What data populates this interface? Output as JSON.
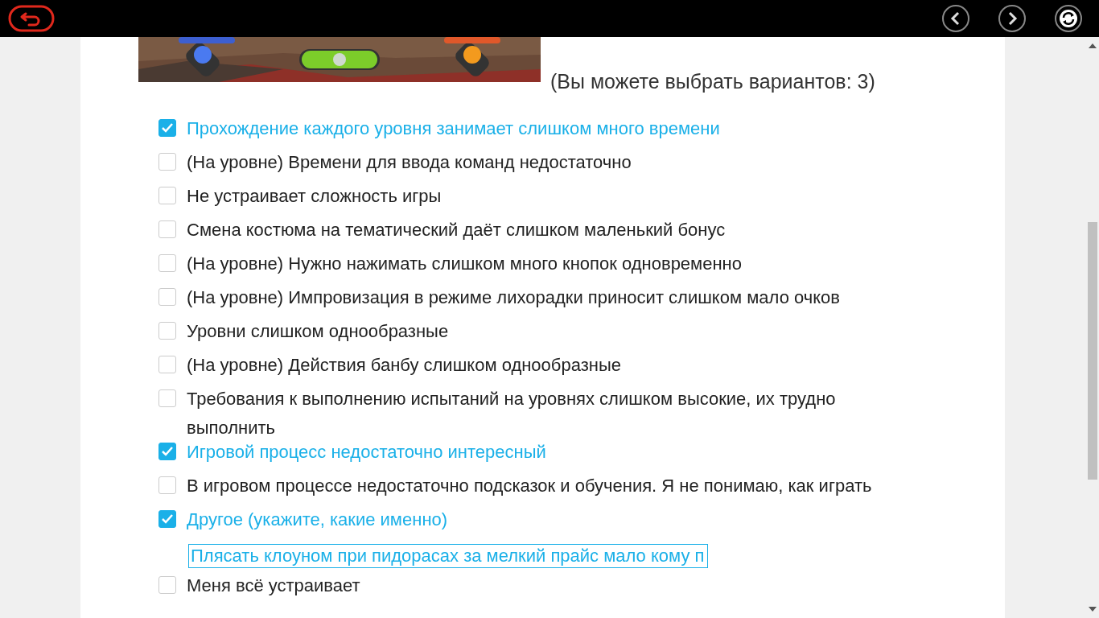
{
  "question": {
    "hint": "(Вы можете выбрать вариантов: 3)"
  },
  "options": [
    {
      "label": "Прохождение каждого уровня занимает слишком много времени",
      "checked": true
    },
    {
      "label": "(На уровне) Времени для ввода команд недостаточно",
      "checked": false
    },
    {
      "label": "Не устраивает сложность игры",
      "checked": false
    },
    {
      "label": "Смена костюма на тематический даёт слишком маленький бонус",
      "checked": false
    },
    {
      "label": "(На уровне) Нужно нажимать слишком много кнопок одновременно",
      "checked": false
    },
    {
      "label": "(На уровне) Импровизация в режиме лихорадки приносит слишком мало очков",
      "checked": false
    },
    {
      "label": "Уровни слишком однообразные",
      "checked": false
    },
    {
      "label": "(На уровне) Действия банбу слишком однообразные",
      "checked": false
    },
    {
      "label": "Требования к выполнению испытаний на уровнях слишком высокие, их трудно выполнить",
      "checked": false
    },
    {
      "label": "Игровой процесс недостаточно интересный",
      "checked": true
    },
    {
      "label": "В игровом процессе недостаточно подсказок и обучения. Я не понимаю, как играть",
      "checked": false
    },
    {
      "label": "Другое (укажите, какие именно)",
      "checked": true,
      "input": {
        "value": "Плясать клоуном при пидорасах за мелкий прайс мало кому п"
      }
    },
    {
      "label": "Меня всё устраивает",
      "checked": false
    }
  ]
}
